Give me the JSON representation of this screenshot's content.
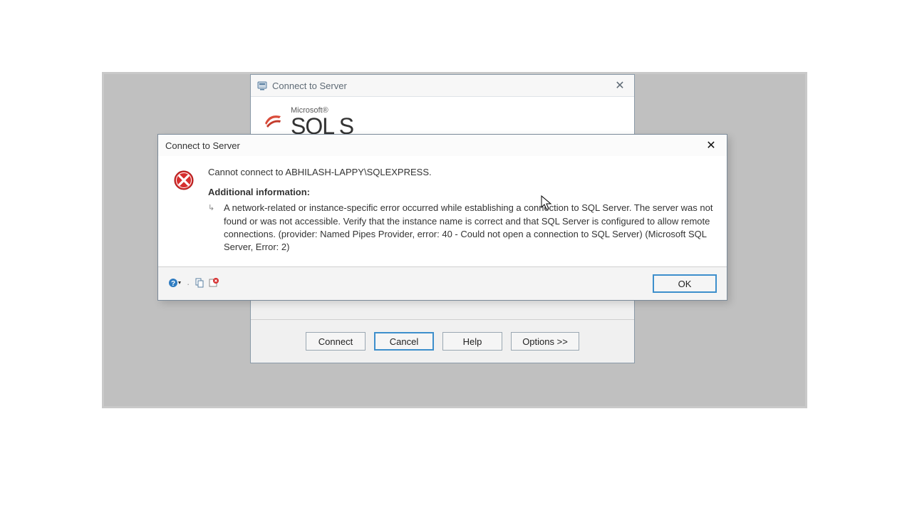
{
  "parent_dialog": {
    "title": "Connect to Server",
    "branding": {
      "ms": "Microsoft®",
      "sql_prefix": "SQL S"
    },
    "buttons": {
      "connect": "Connect",
      "cancel": "Cancel",
      "help": "Help",
      "options": "Options >>"
    }
  },
  "error_dialog": {
    "title": "Connect to Server",
    "main_message": "Cannot connect to ABHILASH-LAPPY\\SQLEXPRESS.",
    "additional_heading": "Additional information:",
    "detail": "A network-related or instance-specific error occurred while establishing a connection to SQL Server. The server was not found or was not accessible. Verify that the instance name is correct and that SQL Server is configured to allow remote connections. (provider: Named Pipes Provider, error: 40 - Could not open a connection to SQL Server) (Microsoft SQL Server, Error: 2)",
    "ok": "OK"
  },
  "icons": {
    "help": "help-icon",
    "copy": "copy-icon",
    "error_small": "error-small-icon"
  }
}
